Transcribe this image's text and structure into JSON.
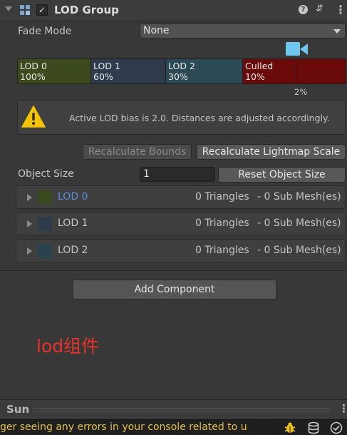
{
  "header": {
    "title": "LOD Group",
    "enabled_check": "✓",
    "help_glyph": "?",
    "preset_glyph": "⇵",
    "menu_glyph": "⋮"
  },
  "fade_mode": {
    "label": "Fade Mode",
    "value": "None"
  },
  "lod_bar": {
    "segments": [
      {
        "name": "LOD 0",
        "percent": "100%",
        "color": "#3c4a1e"
      },
      {
        "name": "LOD 1",
        "percent": "60%",
        "color": "#2f3b4d"
      },
      {
        "name": "LOD 2",
        "percent": "30%",
        "color": "#2c4a55"
      },
      {
        "name": "Culled",
        "percent": "10%",
        "color": "#6a0a0a"
      }
    ],
    "marker_label": "2%"
  },
  "warning": {
    "text": "Active LOD bias is 2.0. Distances are adjusted accordingly."
  },
  "buttons": {
    "recalc_bounds": "Recalculate Bounds",
    "recalc_lightmap": "Recalculate Lightmap Scale",
    "reset_object_size": "Reset Object Size",
    "add_component": "Add Component"
  },
  "object_size": {
    "label": "Object Size",
    "value": "1"
  },
  "lod_rows": [
    {
      "label": "LOD 0",
      "triangles": "0 Triangles",
      "submesh": "-  0 Sub Mesh(es)",
      "swatch": "#3b4a1e",
      "label_color": "#5b8ee0"
    },
    {
      "label": "LOD 1",
      "triangles": "0 Triangles",
      "submesh": "-  0 Sub Mesh(es)",
      "swatch": "#2c3a4c",
      "label_color": "#c4c4c4"
    },
    {
      "label": "LOD 2",
      "triangles": "0 Triangles",
      "submesh": "-  0 Sub Mesh(es)",
      "swatch": "#29424d",
      "label_color": "#c4c4c4"
    }
  ],
  "annotation": "lod组件",
  "sun": {
    "label": "Sun",
    "menu_glyph": "⋮"
  },
  "status": {
    "text": "ger seeing any errors in your console related to u"
  },
  "colors": {
    "accent_camera": "#6fc7ef",
    "warning_yellow": "#f5c400",
    "annotation_red": "#e8322b"
  }
}
